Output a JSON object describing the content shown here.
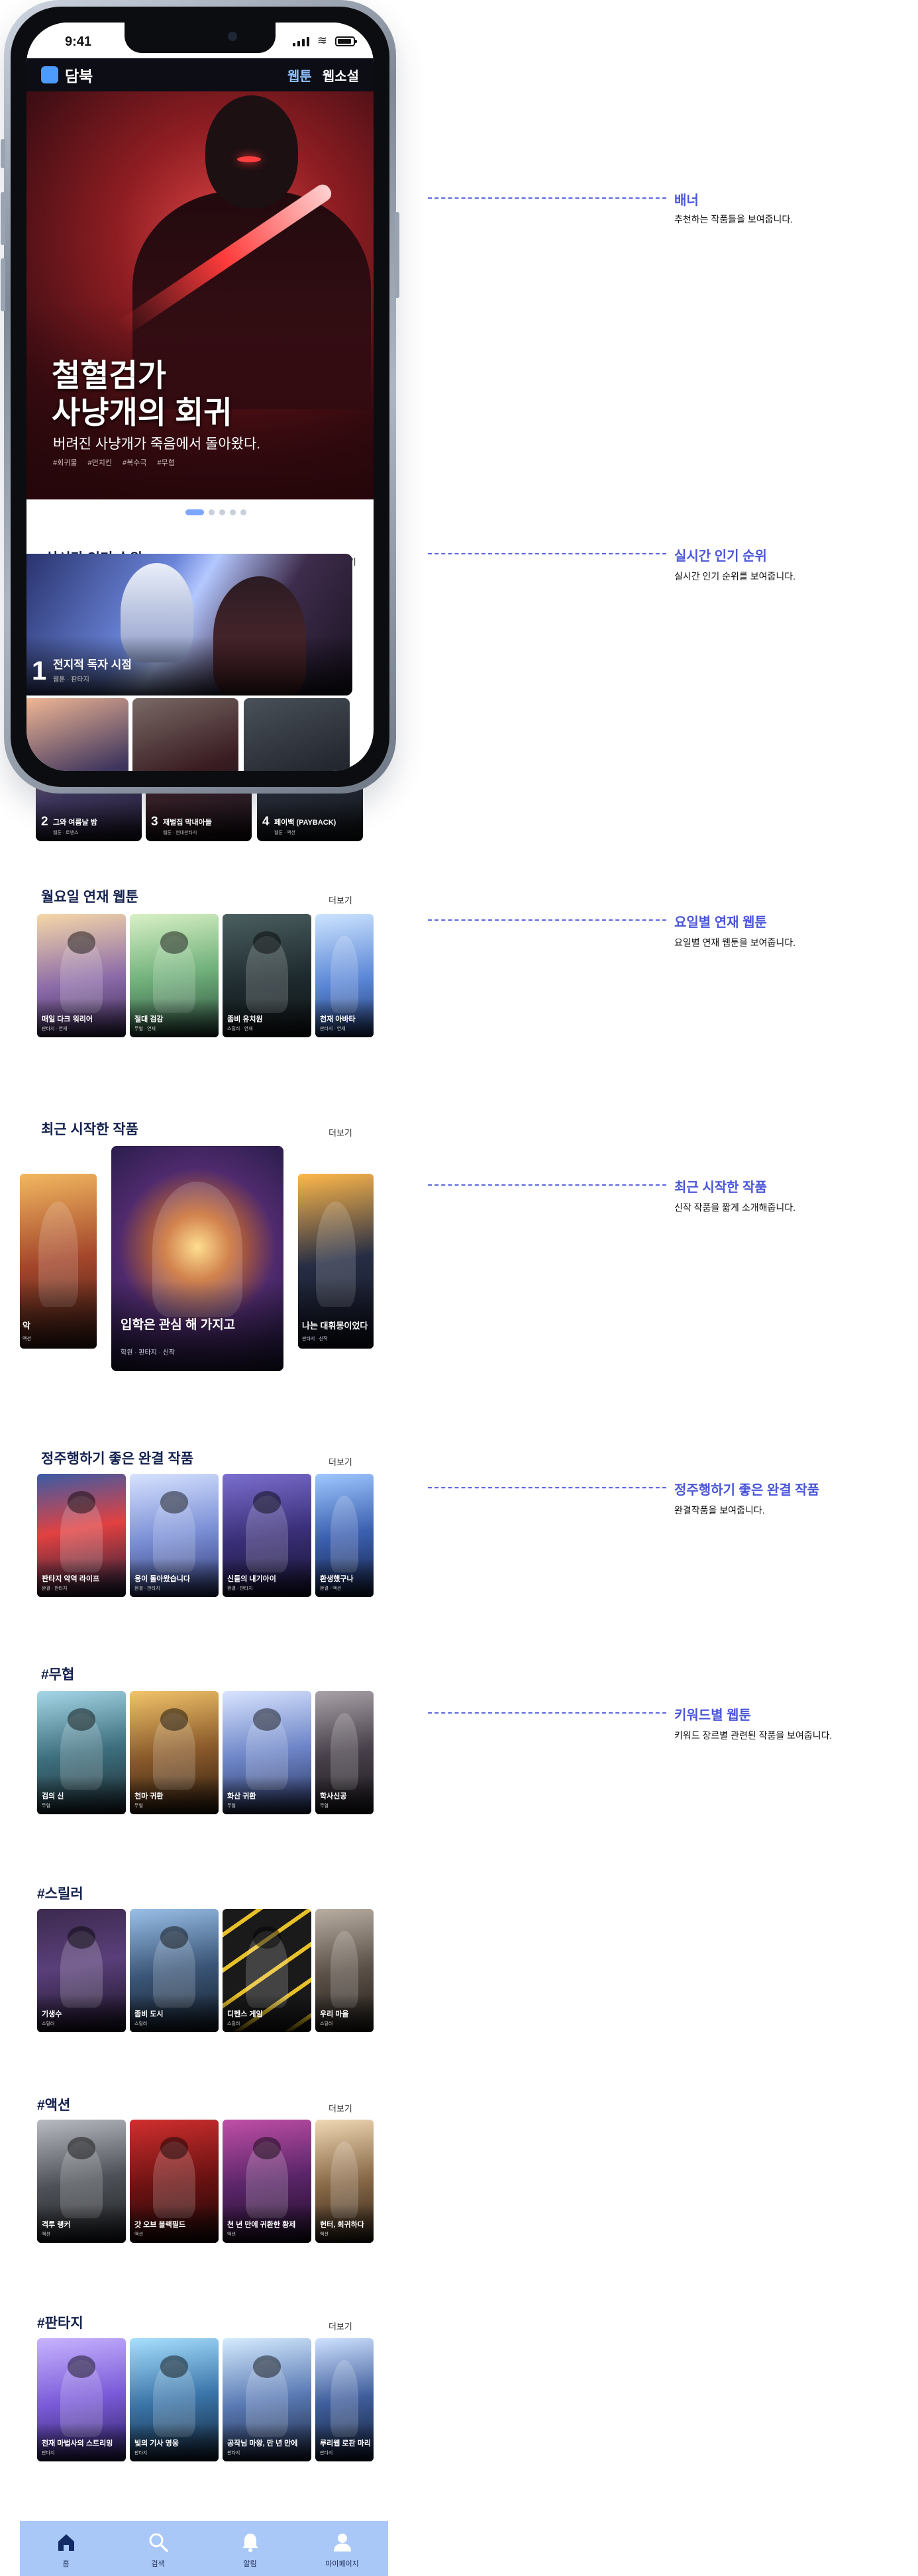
{
  "status_bar": {
    "time": "9:41"
  },
  "app": {
    "logo": "담북",
    "tabs": [
      {
        "label": "웹툰",
        "active": true
      },
      {
        "label": "웹소설",
        "active": false
      }
    ]
  },
  "banner": {
    "title_line1": "철혈검가",
    "title_line2": "사냥개의 회귀",
    "subtitle": "버려진 사냥개가 죽음에서 돌아왔다.",
    "tags": [
      "#회귀물",
      "#먼치킨",
      "#복수극",
      "#무협"
    ]
  },
  "ranking": {
    "title": "실시간 인기 순위",
    "more": "더보기",
    "top": {
      "rank": "1",
      "title": "전지적 독자 시점",
      "meta": "웹툰 · 판타지"
    },
    "items": [
      {
        "rank": "2",
        "title": "그와 여름날 밤",
        "meta": "웹툰 · 로맨스"
      },
      {
        "rank": "3",
        "title": "재벌집 막내아들",
        "meta": "웹툰 · 현대판타지"
      },
      {
        "rank": "4",
        "title": "페이백 (PAYBACK)",
        "meta": "웹툰 · 액션"
      }
    ]
  },
  "weekday": {
    "title": "월요일 연재 웹툰",
    "more": "더보기",
    "cards": [
      {
        "title": "매일 다크 워리어",
        "meta": "판타지 · 연재"
      },
      {
        "title": "절대 검감",
        "meta": "무협 · 연재"
      },
      {
        "title": "좀비 유치원",
        "meta": "스릴러 · 연재"
      },
      {
        "title": "천재 아바타",
        "meta": "판타지 · 연재"
      }
    ]
  },
  "new_works": {
    "title": "최근 시작한 작품",
    "more": "더보기",
    "center": {
      "title": "입학은 관심 해 가지고",
      "meta": "학원 · 판타지 · 신작"
    },
    "left": {
      "title": "악",
      "meta": "액션"
    },
    "right": {
      "title": "나는 대휘몽이었다",
      "meta": "판타지 · 신작"
    }
  },
  "completed": {
    "title": "정주행하기 좋은 완결 작품",
    "more": "더보기",
    "cards": [
      {
        "title": "판타지 악역 라이프",
        "meta": "완결 · 판타지"
      },
      {
        "title": "용이 돌아왔습니다",
        "meta": "완결 · 판타지"
      },
      {
        "title": "신들의 내기아이",
        "meta": "완결 · 판타지"
      },
      {
        "title": "환생했구나",
        "meta": "완결 · 액션"
      }
    ]
  },
  "keyword_sections": [
    {
      "title": "#무협",
      "more": "",
      "cards": [
        {
          "title": "검의 신",
          "meta": "무협"
        },
        {
          "title": "천마 귀환",
          "meta": "무협"
        },
        {
          "title": "화산 귀환",
          "meta": "무협"
        },
        {
          "title": "학사신공",
          "meta": "무협"
        }
      ]
    },
    {
      "title": "#스릴러",
      "more": "",
      "cards": [
        {
          "title": "기생수",
          "meta": "스릴러"
        },
        {
          "title": "좀비 도시",
          "meta": "스릴러"
        },
        {
          "title": "디펜스 게임",
          "meta": "스릴러"
        },
        {
          "title": "우리 마을",
          "meta": "스릴러"
        }
      ]
    },
    {
      "title": "#액션",
      "more": "더보기",
      "cards": [
        {
          "title": "격투 랭커",
          "meta": "액션"
        },
        {
          "title": "갓 오브 블랙필드",
          "meta": "액션"
        },
        {
          "title": "천 년 만에 귀환한 황제",
          "meta": "액션"
        },
        {
          "title": "헌터, 회귀하다",
          "meta": "액션"
        }
      ]
    },
    {
      "title": "#판타지",
      "more": "더보기",
      "cards": [
        {
          "title": "천재 마법사의 스트리밍",
          "meta": "판타지"
        },
        {
          "title": "빛의 기사 영웅",
          "meta": "판타지"
        },
        {
          "title": "공작님 마왕, 만 년 만에",
          "meta": "판타지"
        },
        {
          "title": "루리웹 로판 마리",
          "meta": "판타지"
        }
      ]
    }
  ],
  "annotations": [
    {
      "title": "배너",
      "desc": "추천하는 작품들을 보여줍니다."
    },
    {
      "title": "실시간 인기 순위",
      "desc": "실시간 인기 순위를 보여줍니다."
    },
    {
      "title": "요일별 연재 웹툰",
      "desc": "요일별 연재 웹툰을 보여줍니다."
    },
    {
      "title": "최근 시작한 작품",
      "desc": "신작 작품을 짧게 소개해줍니다."
    },
    {
      "title": "정주행하기 좋은 완결 작품",
      "desc": "완결작품을 보여줍니다."
    },
    {
      "title": "키워드별 웹툰",
      "desc": "키워드 장르별 관련된 작품을 보여줍니다."
    }
  ],
  "tab_bar": [
    {
      "label": "홈",
      "icon": "home-icon"
    },
    {
      "label": "검색",
      "icon": "search-icon"
    },
    {
      "label": "알림",
      "icon": "bell-icon"
    },
    {
      "label": "마이페이지",
      "icon": "user-icon"
    }
  ],
  "colors": {
    "accent": "#4a55d8",
    "tab_bar_bg": "#a9c8f7",
    "title_navy": "#14214d",
    "hero_red": "#8e1d22"
  }
}
